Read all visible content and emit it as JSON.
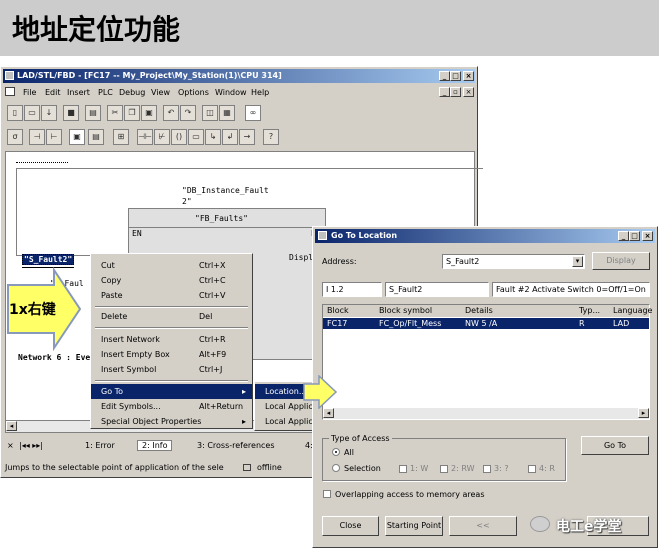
{
  "slide": {
    "title": "地址定位功能",
    "arrow_label": "1x右键",
    "watermark": "电工e学堂",
    "colors": {
      "header_bg": "#cccccc",
      "arrow_fill": "#ffff66",
      "arrow_border": "#99aacc",
      "title_bar": "#0a246a",
      "selection": "#0a246a"
    }
  },
  "editor": {
    "title": "LAD/STL/FBD  - [FC17 -- My_Project\\My_Station(1)\\CPU 314]",
    "menu": [
      "File",
      "Edit",
      "Insert",
      "PLC",
      "Debug",
      "View",
      "Options",
      "Window",
      "Help"
    ],
    "network_title": "Network 6 : Eve",
    "canvas": {
      "db_instance": "\"DB_Instance_Fault",
      "db_instance2": "2\"",
      "fb_faults": "\"FB_Faults\"",
      "en": "EN",
      "eno": "E",
      "s_fault2": "\"S_Fault2\"",
      "t_faul": "\"T_Faul",
      "displ": "Displ"
    },
    "tabs": [
      "1: Error",
      "2: Info",
      "3: Cross-references",
      "4:"
    ],
    "status_hint": "Jumps to the selectable point of application of the sele",
    "status_mode": "offline"
  },
  "context_menu": {
    "items": [
      {
        "label": "Cut",
        "shortcut": "Ctrl+X"
      },
      {
        "label": "Copy",
        "shortcut": "Ctrl+C"
      },
      {
        "label": "Paste",
        "shortcut": "Ctrl+V"
      },
      {
        "label": "Delete",
        "shortcut": "Del"
      },
      {
        "label": "Insert Network",
        "shortcut": "Ctrl+R"
      },
      {
        "label": "Insert Empty Box",
        "shortcut": "Alt+F9"
      },
      {
        "label": "Insert Symbol",
        "shortcut": "Ctrl+J"
      },
      {
        "label": "Go To",
        "shortcut": ""
      },
      {
        "label": "Edit Symbols...",
        "shortcut": "Alt+Return"
      },
      {
        "label": "Special Object Properties",
        "shortcut": ""
      }
    ],
    "submenu": [
      "Location...",
      "Local Applic",
      "Local Applic"
    ]
  },
  "goto_dialog": {
    "title": "Go To Location",
    "address_label": "Address:",
    "address_value": "S_Fault2",
    "display_button": "Display",
    "info_row": {
      "addr": "I     1.2",
      "symbol": "S_Fault2",
      "comment": "Fault #2 Activate Switch 0=Off/1=On"
    },
    "columns": [
      "Block",
      "Block symbol",
      "Details",
      "Typ...",
      "Language"
    ],
    "rows": [
      {
        "block": "FC17",
        "symbol": "FC_Op/Flt_Mess",
        "details": "NW  5  /A",
        "type": "R",
        "language": "LAD"
      }
    ],
    "type_of_access": "Type of Access",
    "radio_all": "All",
    "radio_selection": "Selection",
    "access_checks": [
      "1: W",
      "2: RW",
      "3: ?",
      "4: R"
    ],
    "goto_button": "Go To",
    "overlap_label": "Overlapping access to memory areas",
    "close_button": "Close",
    "starting_point_button": "Starting Point",
    "prev_button": "<<"
  }
}
